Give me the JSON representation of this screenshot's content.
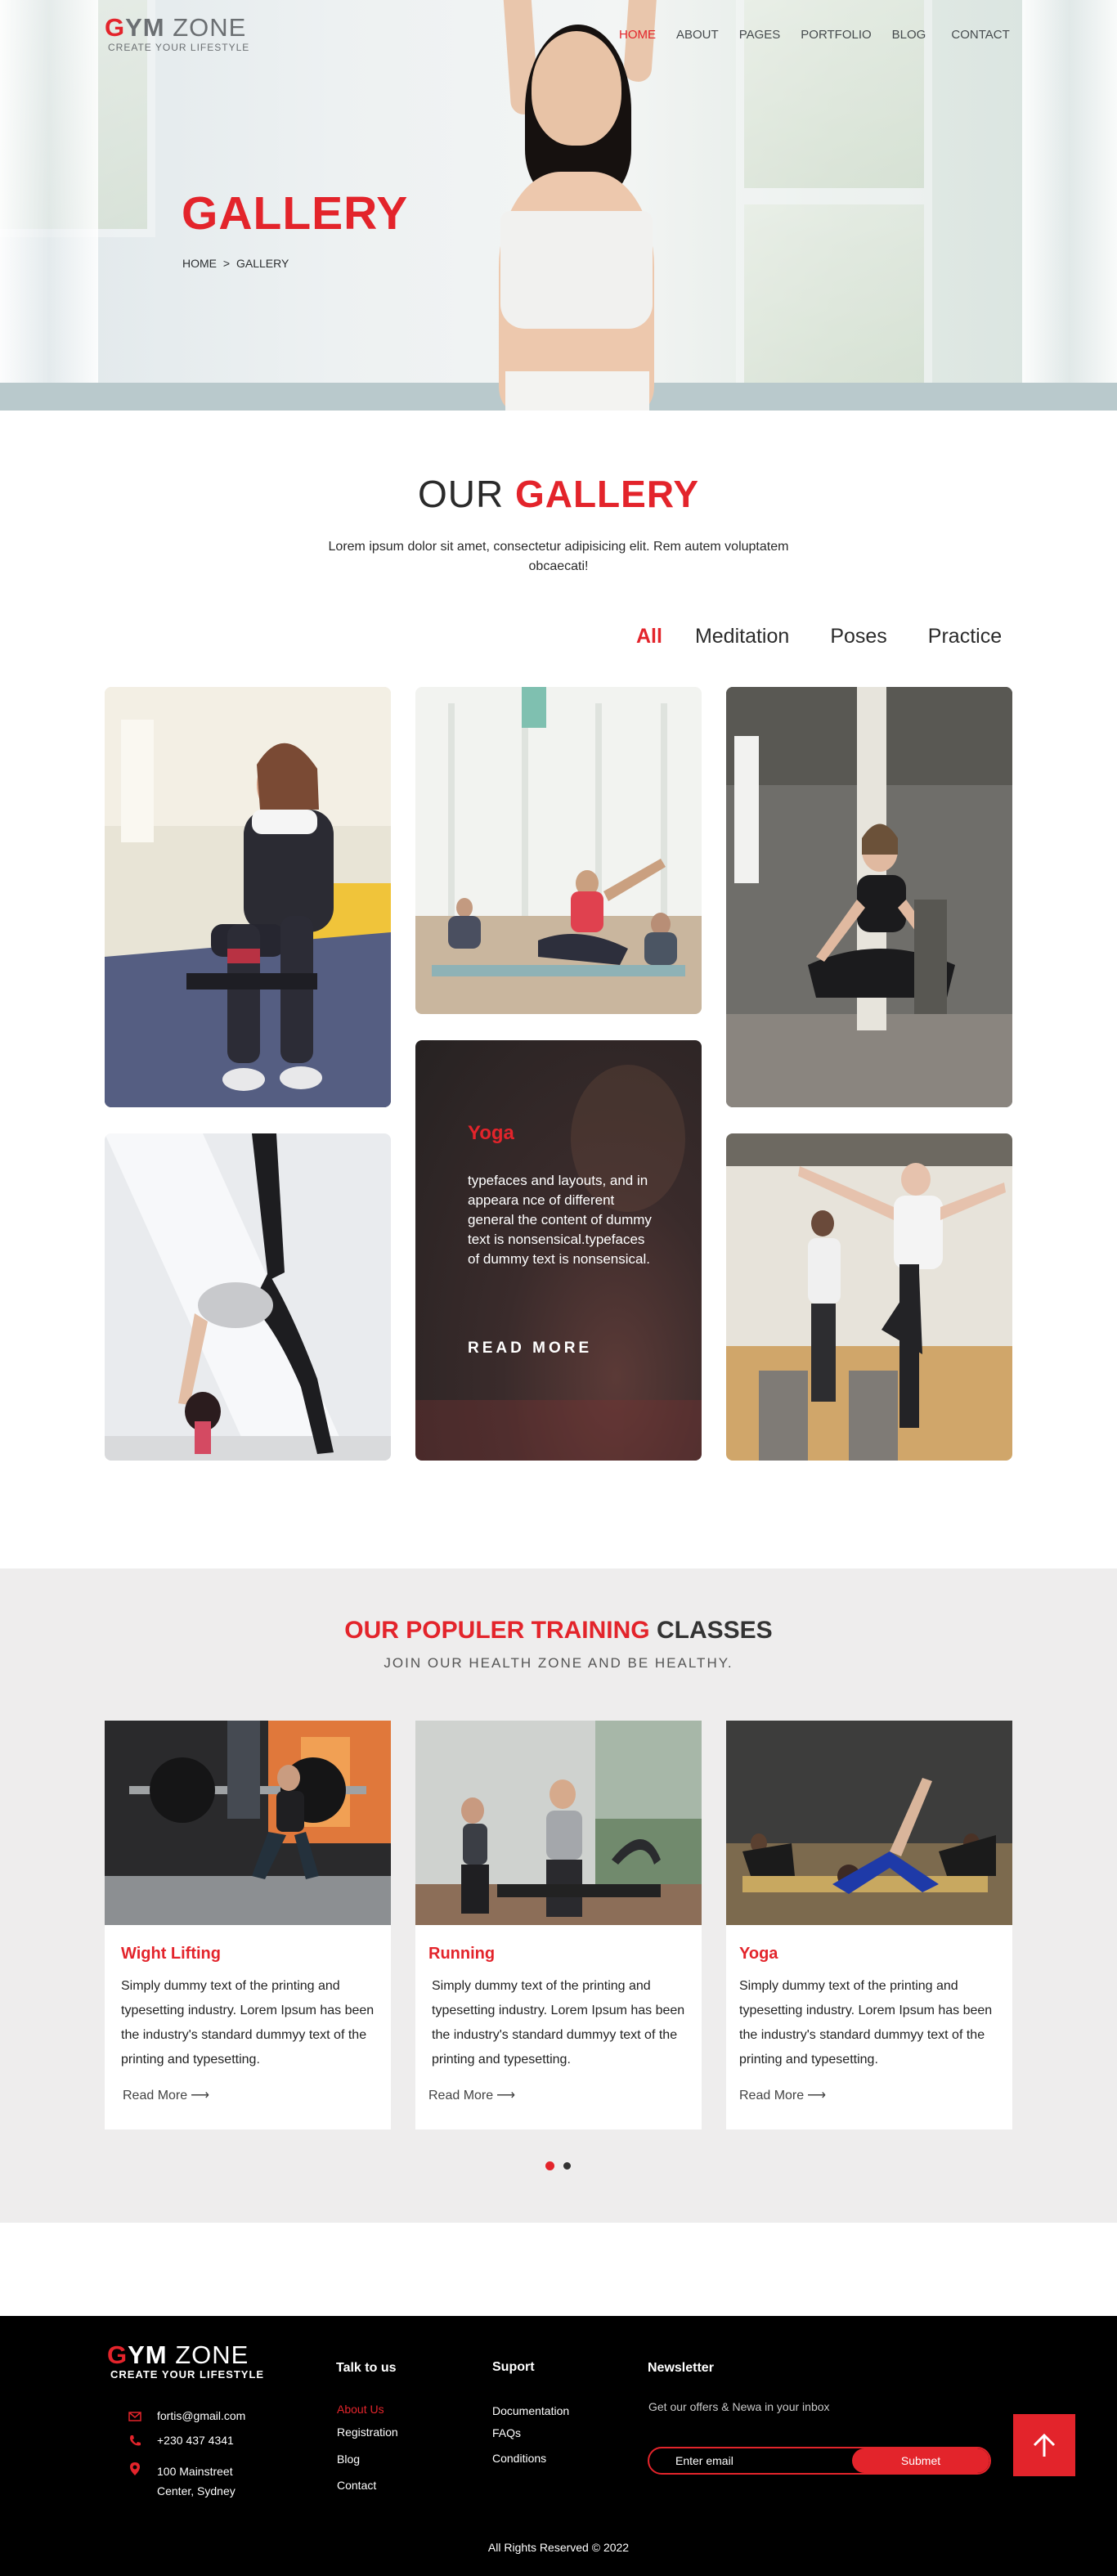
{
  "brand": {
    "g": "G",
    "ym": "YM",
    "zone": " ZONE",
    "tagline": "CREATE YOUR LIFESTYLE"
  },
  "nav": {
    "items": [
      {
        "label": "HOME",
        "active": true
      },
      {
        "label": "ABOUT"
      },
      {
        "label": "PAGES"
      },
      {
        "label": "PORTFOLIO"
      },
      {
        "label": "BLOG"
      },
      {
        "label": "CONTACT"
      }
    ]
  },
  "hero": {
    "title": "GALLERY",
    "breadcrumb": {
      "home": "HOME",
      "sep": ">",
      "current": "GALLERY"
    }
  },
  "gallery": {
    "title_light": "OUR ",
    "title_bold": "GALLERY",
    "subtitle": "Lorem ipsum dolor sit amet, consectetur adipisicing elit. Rem autem voluptatem obcaecati!",
    "filters": [
      "All",
      "Meditation",
      "Poses",
      "Practice"
    ],
    "active_filter": "All",
    "overlay": {
      "title": "Yoga",
      "body": "typefaces and layouts, and in appeara nce of different general the content of dummy text is nonsensical.typefaces of dummy text is nonsensical.",
      "cta": "READ MORE"
    }
  },
  "classes": {
    "title_red": "OUR POPULER TRAINING",
    "title_light": " CLASSES",
    "subtitle": "JOIN OUR HEALTH ZONE AND BE HEALTHY.",
    "cards": [
      {
        "title": "Wight Lifting",
        "body": "Simply dummy text of the printing and typesetting industry. Lorem Ipsum has been the industry's standard dummyy text of the printing and typesetting.",
        "cta": "Read More"
      },
      {
        "title": "Running",
        "body": "Simply dummy text of the printing and typesetting industry. Lorem Ipsum has been the industry's standard dummyy text of the printing and typesetting.",
        "cta": "Read More"
      },
      {
        "title": "Yoga",
        "body": "Simply dummy text of the printing and typesetting industry. Lorem Ipsum has been the industry's standard dummyy text of the printing and typesetting.",
        "cta": "Read More"
      }
    ],
    "carousel": {
      "page_count": 2,
      "active_index": 0
    }
  },
  "footer": {
    "contact": {
      "email": "fortis@gmail.com",
      "phone": "+230 437 4341",
      "address_1": "100 Mainstreet",
      "address_2": "Center, Sydney"
    },
    "talk": {
      "title": "Talk to us",
      "links": [
        "About Us",
        "Registration",
        "Blog",
        "Contact"
      ]
    },
    "support": {
      "title": "Suport",
      "links": [
        "Documentation",
        "FAQs",
        "Conditions"
      ]
    },
    "newsletter": {
      "title": "Newsletter",
      "text": "Get our offers & Newa in your inbox",
      "placeholder": "Enter email",
      "button": "Submet"
    },
    "copyright": "All Rights Reserved © 2022"
  },
  "colors": {
    "accent": "#e3242b",
    "footer_bg": "#000000",
    "classes_bg": "#eeeded"
  },
  "icons": {
    "email": "envelope-icon",
    "phone": "phone-icon",
    "address": "map-pin-icon",
    "to_top": "arrow-up-icon",
    "read_more": "arrow-right-icon"
  }
}
